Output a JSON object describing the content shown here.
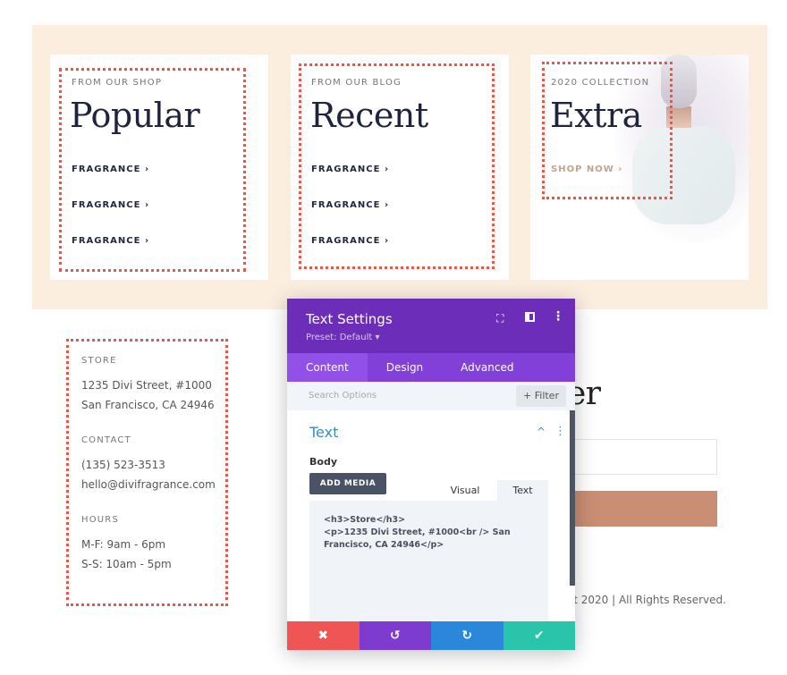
{
  "cards": [
    {
      "eyebrow": "FROM OUR SHOP",
      "title": "Popular",
      "links": [
        "FRAGRANCE",
        "FRAGRANCE",
        "FRAGRANCE"
      ]
    },
    {
      "eyebrow": "FROM OUR BLOG",
      "title": "Recent",
      "links": [
        "FRAGRANCE",
        "FRAGRANCE",
        "FRAGRANCE"
      ]
    },
    {
      "eyebrow": "2020 COLLECTION",
      "title": "Extra",
      "link": "SHOP NOW"
    }
  ],
  "info": {
    "store_label": "STORE",
    "store_line1": "1235 Divi Street, #1000",
    "store_line2": "San Francisco, CA 24946",
    "contact_label": "CONTACT",
    "phone": "(135) 523-3513",
    "email": "hello@divifragrance.com",
    "hours_label": "HOURS",
    "hours1": "M-F: 9am - 6pm",
    "hours2": "S-S: 10am - 5pm"
  },
  "newsletter": {
    "title_partial": "ter",
    "copyright_partial": "ght 2020 | All Rights Reserved."
  },
  "panel": {
    "title": "Text Settings",
    "preset": "Preset: Default",
    "tabs": [
      "Content",
      "Design",
      "Advanced"
    ],
    "search_placeholder": "Search Options",
    "filter": "Filter",
    "section": "Text",
    "body_label": "Body",
    "add_media": "ADD MEDIA",
    "editor_tabs": [
      "Visual",
      "Text"
    ],
    "code": "<h3>Store</h3>\n<p>1235 Divi Street, #1000<br /> San Francisco, CA 24946</p>"
  },
  "colors": {
    "accent_purple": "#6c2eb9",
    "cancel": "#ef5555",
    "undo": "#7e3bd0",
    "redo": "#2b87da",
    "save": "#29c4a9",
    "button_copper": "#c98e73"
  }
}
